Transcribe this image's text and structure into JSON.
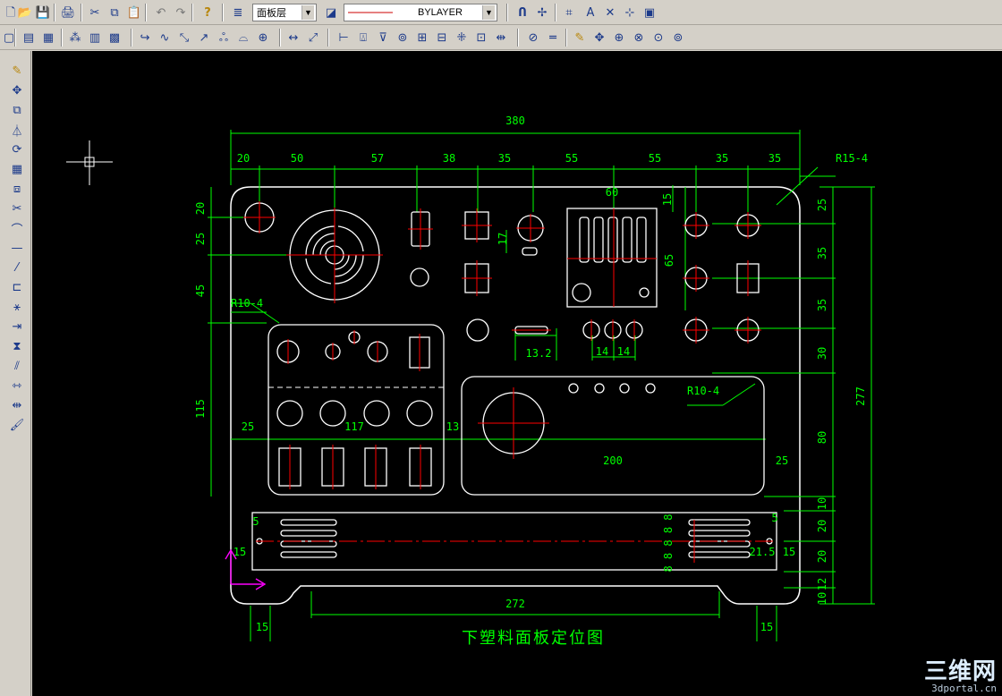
{
  "toolbar_top": {
    "layer_combo_value": "面板层",
    "linetype_combo_value": "BYLAYER",
    "icons": [
      "new-file-icon",
      "open-file-icon",
      "save-icon",
      "print-icon",
      "cut-icon",
      "copy-icon",
      "paste-icon",
      "undo-icon",
      "redo-icon",
      "help-icon",
      "layer-manager-icon",
      "layer-properties-icon",
      "polyline-icon",
      "point-edit-icon",
      "measure-icon",
      "text-style-icon",
      "trim-icon",
      "zoom-icon",
      "image-icon"
    ]
  },
  "toolbar_second": {
    "icons": [
      "window-icon",
      "block-icon",
      "table-icon",
      "calculator-icon",
      "move-icon",
      "arc-icon",
      "constrain-icon",
      "arrow-icon",
      "group-icon",
      "explode-icon",
      "snap-icon",
      "dimension-linear-icon",
      "dimension-aligned-icon",
      "dimension-ordinate-icon",
      "dimension-radius-icon",
      "dimension-diameter-icon",
      "dimension-angular-icon",
      "leader-icon",
      "tolerance-icon",
      "center-mark-icon",
      "dimension-edit-icon",
      "dimension-text-edit-icon",
      "inquiry-icon",
      "distance-icon",
      "pencil-icon",
      "zoom-realtime-icon",
      "zoom-window-icon",
      "zoom-previous-icon",
      "zoom-extents-icon",
      "zoom-all-icon"
    ]
  },
  "left_toolbar": {
    "icons": [
      "erase-icon",
      "move-icon",
      "copy-icon",
      "mirror-icon",
      "rotate-icon",
      "array-icon",
      "offset-icon",
      "scale-icon",
      "stretch-icon",
      "trim-icon",
      "extend-icon",
      "break-icon",
      "chamfer-icon",
      "fillet-icon",
      "align-icon",
      "properties-icon",
      "matchprop-icon",
      "explode-icon",
      "hatch-icon"
    ]
  },
  "drawing": {
    "title": "下塑料面板定位图",
    "dims_top": [
      "380",
      "20",
      "50",
      "57",
      "38",
      "35",
      "55",
      "55",
      "35",
      "35"
    ],
    "label_r15": "R15-4",
    "label_r10_left": "R10-4",
    "label_r10_right": "R10-4",
    "dims_left": [
      "20",
      "25",
      "45",
      "115"
    ],
    "dims_right": [
      "25",
      "35",
      "35",
      "30",
      "80",
      "10",
      "20",
      "20",
      "12",
      "10"
    ],
    "dim_total_right": "277",
    "dims_inner": {
      "d60": "60",
      "d15": "15",
      "d17": "17",
      "d65": "65",
      "d13_2": "13.2",
      "d14a": "14",
      "d14b": "14",
      "d25_left": "25",
      "d117": "117",
      "d13": "13",
      "d200": "200",
      "d25_right": "25",
      "d5_left": "5",
      "d15_left": "15",
      "d5_right": "5",
      "d21_5": "21.5",
      "d15_right": "15",
      "d8_labels": "8 8 8 8 8",
      "d272": "272",
      "d15_foot_left": "15",
      "d15_foot_right": "15"
    },
    "colors": {
      "outline": "#ffffff",
      "dimension": "#00ff00",
      "centerline": "#ff0000",
      "ucs": "#ff00ff",
      "canvas": "#000000"
    }
  },
  "watermark": {
    "brand": "三维网",
    "url": "3dportal.cn"
  }
}
